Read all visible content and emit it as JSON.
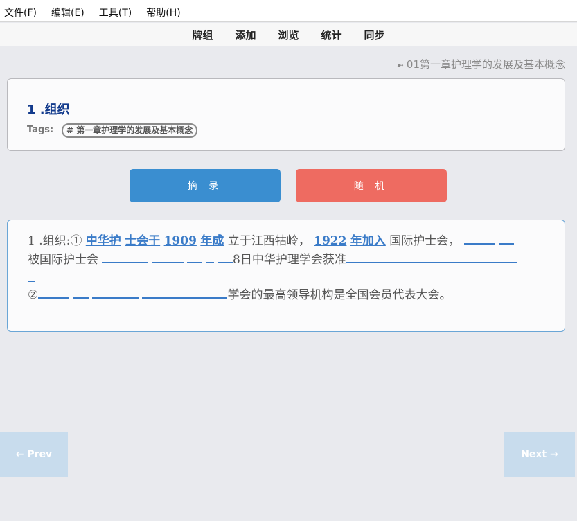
{
  "menu": [
    "文件(F)",
    "编辑(E)",
    "工具(T)",
    "帮助(H)"
  ],
  "toolbar": [
    "牌组",
    "添加",
    "浏览",
    "统计",
    "同步"
  ],
  "deck_path": {
    "arrow": "➼",
    "text": "01第一章护理学的发展及基本概念"
  },
  "card": {
    "title": "1 .组织",
    "tags_label": "Tags:",
    "tag": "# 第一章护理学的发展及基本概念"
  },
  "buttons": {
    "extract": "摘 录",
    "random": "随 机"
  },
  "body": {
    "prefix": "1 .组织:①",
    "link1": "中华护",
    "link2": "士会于",
    "link3": "1909",
    "link4": "年成",
    "text1": "立于江西牯岭，",
    "link5": "1922",
    "link6": "年加入",
    "text2": "国际护士会，",
    "text3": "被国际护士会",
    "text4": "8日中华护理学会获准",
    "circled": "②",
    "text5": "学会的最高领导机构是全国会员代表大会。"
  },
  "nav": {
    "prev": "← Prev",
    "next": "Next →"
  },
  "colors": {
    "accent_blue": "#3a8ed0",
    "accent_red": "#ee6b61",
    "link_blue": "#3a7bc8",
    "title_navy": "#123a8c"
  }
}
